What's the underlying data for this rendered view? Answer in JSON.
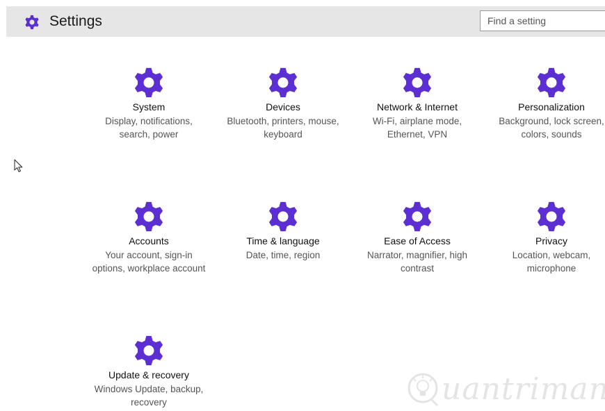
{
  "header": {
    "title": "Settings",
    "icon": "gear-icon",
    "search_placeholder": "Find a setting"
  },
  "accent_color": "#5b2fd1",
  "tiles": [
    {
      "name": "System",
      "desc": "Display, notifications, search, power",
      "icon": "gear-icon"
    },
    {
      "name": "Devices",
      "desc": "Bluetooth, printers, mouse, keyboard",
      "icon": "gear-icon"
    },
    {
      "name": "Network & Internet",
      "desc": "Wi-Fi, airplane mode, Ethernet, VPN",
      "icon": "gear-icon"
    },
    {
      "name": "Personalization",
      "desc": "Background, lock screen, colors, sounds",
      "icon": "gear-icon"
    },
    {
      "name": "Accounts",
      "desc": "Your account, sign-in options, workplace account",
      "icon": "gear-icon"
    },
    {
      "name": "Time & language",
      "desc": "Date, time, region",
      "icon": "gear-icon"
    },
    {
      "name": "Ease of Access",
      "desc": "Narrator, magnifier, high contrast",
      "icon": "gear-icon"
    },
    {
      "name": "Privacy",
      "desc": "Location, webcam, microphone",
      "icon": "gear-icon"
    },
    {
      "name": "Update & recovery",
      "desc": "Windows Update, backup, recovery",
      "icon": "gear-icon"
    }
  ],
  "watermark": {
    "text": "uantrimang",
    "icon": "lightbulb-icon"
  }
}
